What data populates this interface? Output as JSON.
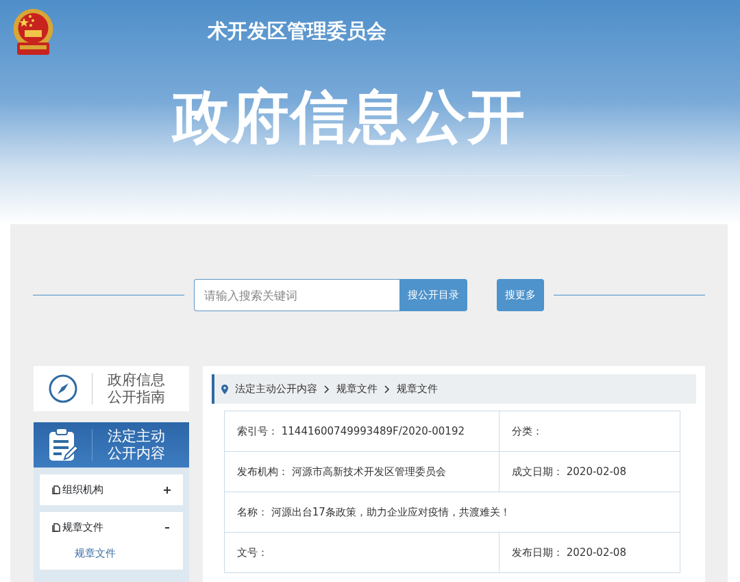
{
  "header": {
    "org_name": "术开发区管理委员会",
    "title": "政府信息公开"
  },
  "search": {
    "placeholder": "请输入搜索关键词",
    "buttons": [
      "搜公开目录",
      "搜更多"
    ]
  },
  "sidebar": {
    "cards": [
      {
        "kind": "guide",
        "label_lines": [
          "政府信息",
          "公开指南"
        ],
        "selected": false
      },
      {
        "kind": "content",
        "label_lines": [
          "法定主动",
          "公开内容"
        ],
        "selected": true
      }
    ],
    "items": [
      {
        "label": "组织机构",
        "expanded": false
      },
      {
        "label": "规章文件",
        "expanded": true,
        "children": [
          {
            "label": "规章文件"
          }
        ]
      }
    ]
  },
  "breadcrumb": [
    "法定主动公开内容",
    "规章文件",
    "规章文件"
  ],
  "details": {
    "rows": [
      [
        {
          "label": "索引号：",
          "value": "11441600749993489F/2020-00192"
        },
        {
          "label": "分类："
        }
      ],
      [
        {
          "label": "发布机构：",
          "value": "河源市高新技术开发区管理委员会"
        },
        {
          "label": "成文日期：",
          "value": "2020-02-08"
        }
      ],
      [
        {
          "label": "名称：",
          "value": "河源出台17条政策，助力企业应对疫情，共渡难关！"
        }
      ],
      [
        {
          "label": "文号："
        },
        {
          "label": "发布日期：",
          "value": "2020-02-08"
        }
      ]
    ]
  }
}
